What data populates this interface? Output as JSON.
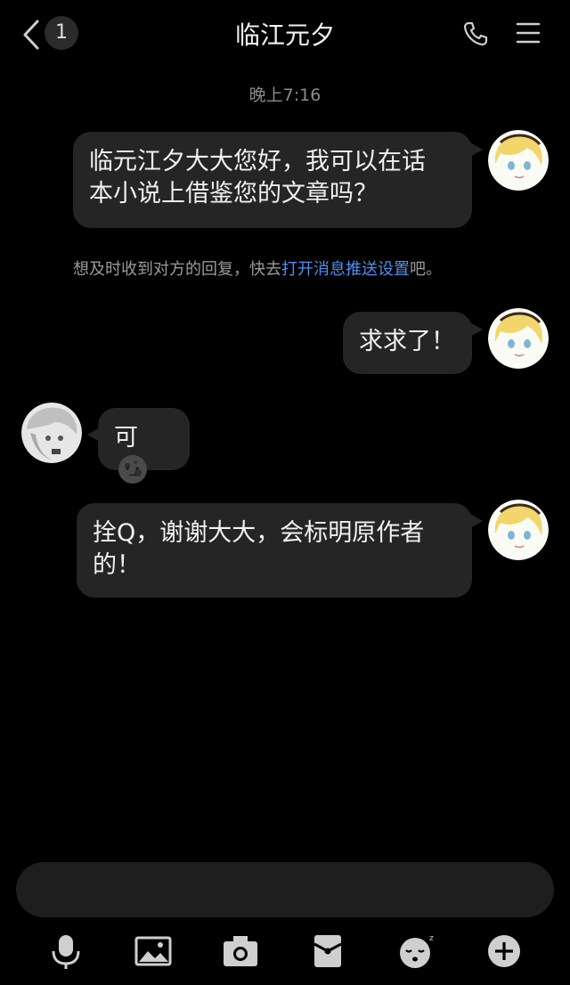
{
  "header": {
    "title": "临江元夕",
    "back_badge": "1"
  },
  "chat": {
    "timestamp": "晚上7:16",
    "messages": [
      {
        "side": "right",
        "text_line1": "临元江夕大大您好，我可以在话",
        "text_line2": "本小说上借鉴您的文章吗？"
      },
      {
        "side": "right",
        "text": "求求了！"
      },
      {
        "side": "left",
        "text": "可",
        "emoji": "new-moon-face"
      },
      {
        "side": "right",
        "text_line1": "拴Q，谢谢大大，会标明原作者",
        "text_line2": "的！"
      }
    ],
    "notice": {
      "prefix": "想及时收到对方的回复，快去",
      "link": "打开消息推送设置",
      "suffix": "吧。"
    }
  },
  "toolbar": {
    "icons": [
      "microphone-icon",
      "image-icon",
      "camera-icon",
      "red-packet-icon",
      "sleepy-face-icon",
      "plus-circle-icon"
    ]
  },
  "colors": {
    "background": "#000000",
    "bubble": "#252525",
    "link": "#4f8ff0"
  }
}
